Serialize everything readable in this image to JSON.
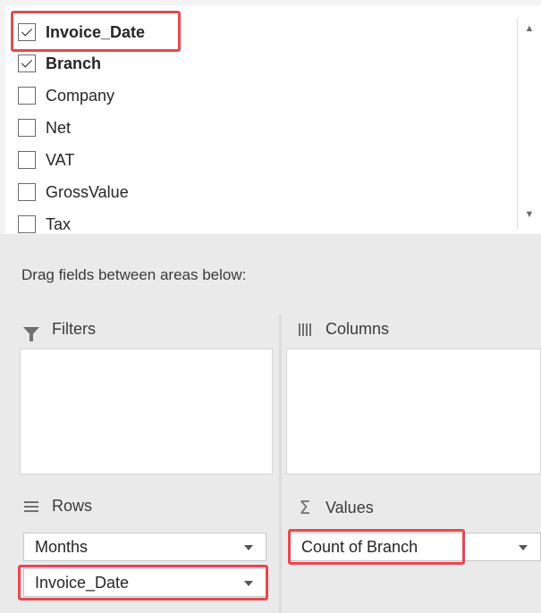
{
  "field_list": {
    "fields": [
      {
        "label": "Invoice_Date",
        "checked": true,
        "bold": true
      },
      {
        "label": "Branch",
        "checked": true,
        "bold": true
      },
      {
        "label": "Company",
        "checked": false,
        "bold": false
      },
      {
        "label": "Net",
        "checked": false,
        "bold": false
      },
      {
        "label": "VAT",
        "checked": false,
        "bold": false
      },
      {
        "label": "GrossValue",
        "checked": false,
        "bold": false
      },
      {
        "label": "Tax",
        "checked": false,
        "bold": false
      }
    ]
  },
  "areas": {
    "drag_label": "Drag fields between areas below:",
    "filters": {
      "title": "Filters",
      "icon": "filter-icon"
    },
    "columns": {
      "title": "Columns",
      "icon": "columns-icon"
    },
    "rows": {
      "title": "Rows",
      "icon": "rows-icon",
      "items": [
        "Months",
        "Invoice_Date"
      ]
    },
    "values": {
      "title": "Values",
      "icon": "sigma-icon",
      "symbol": "Σ",
      "items": [
        "Count of Branch"
      ]
    }
  },
  "colors": {
    "highlight": "#e8484f"
  }
}
